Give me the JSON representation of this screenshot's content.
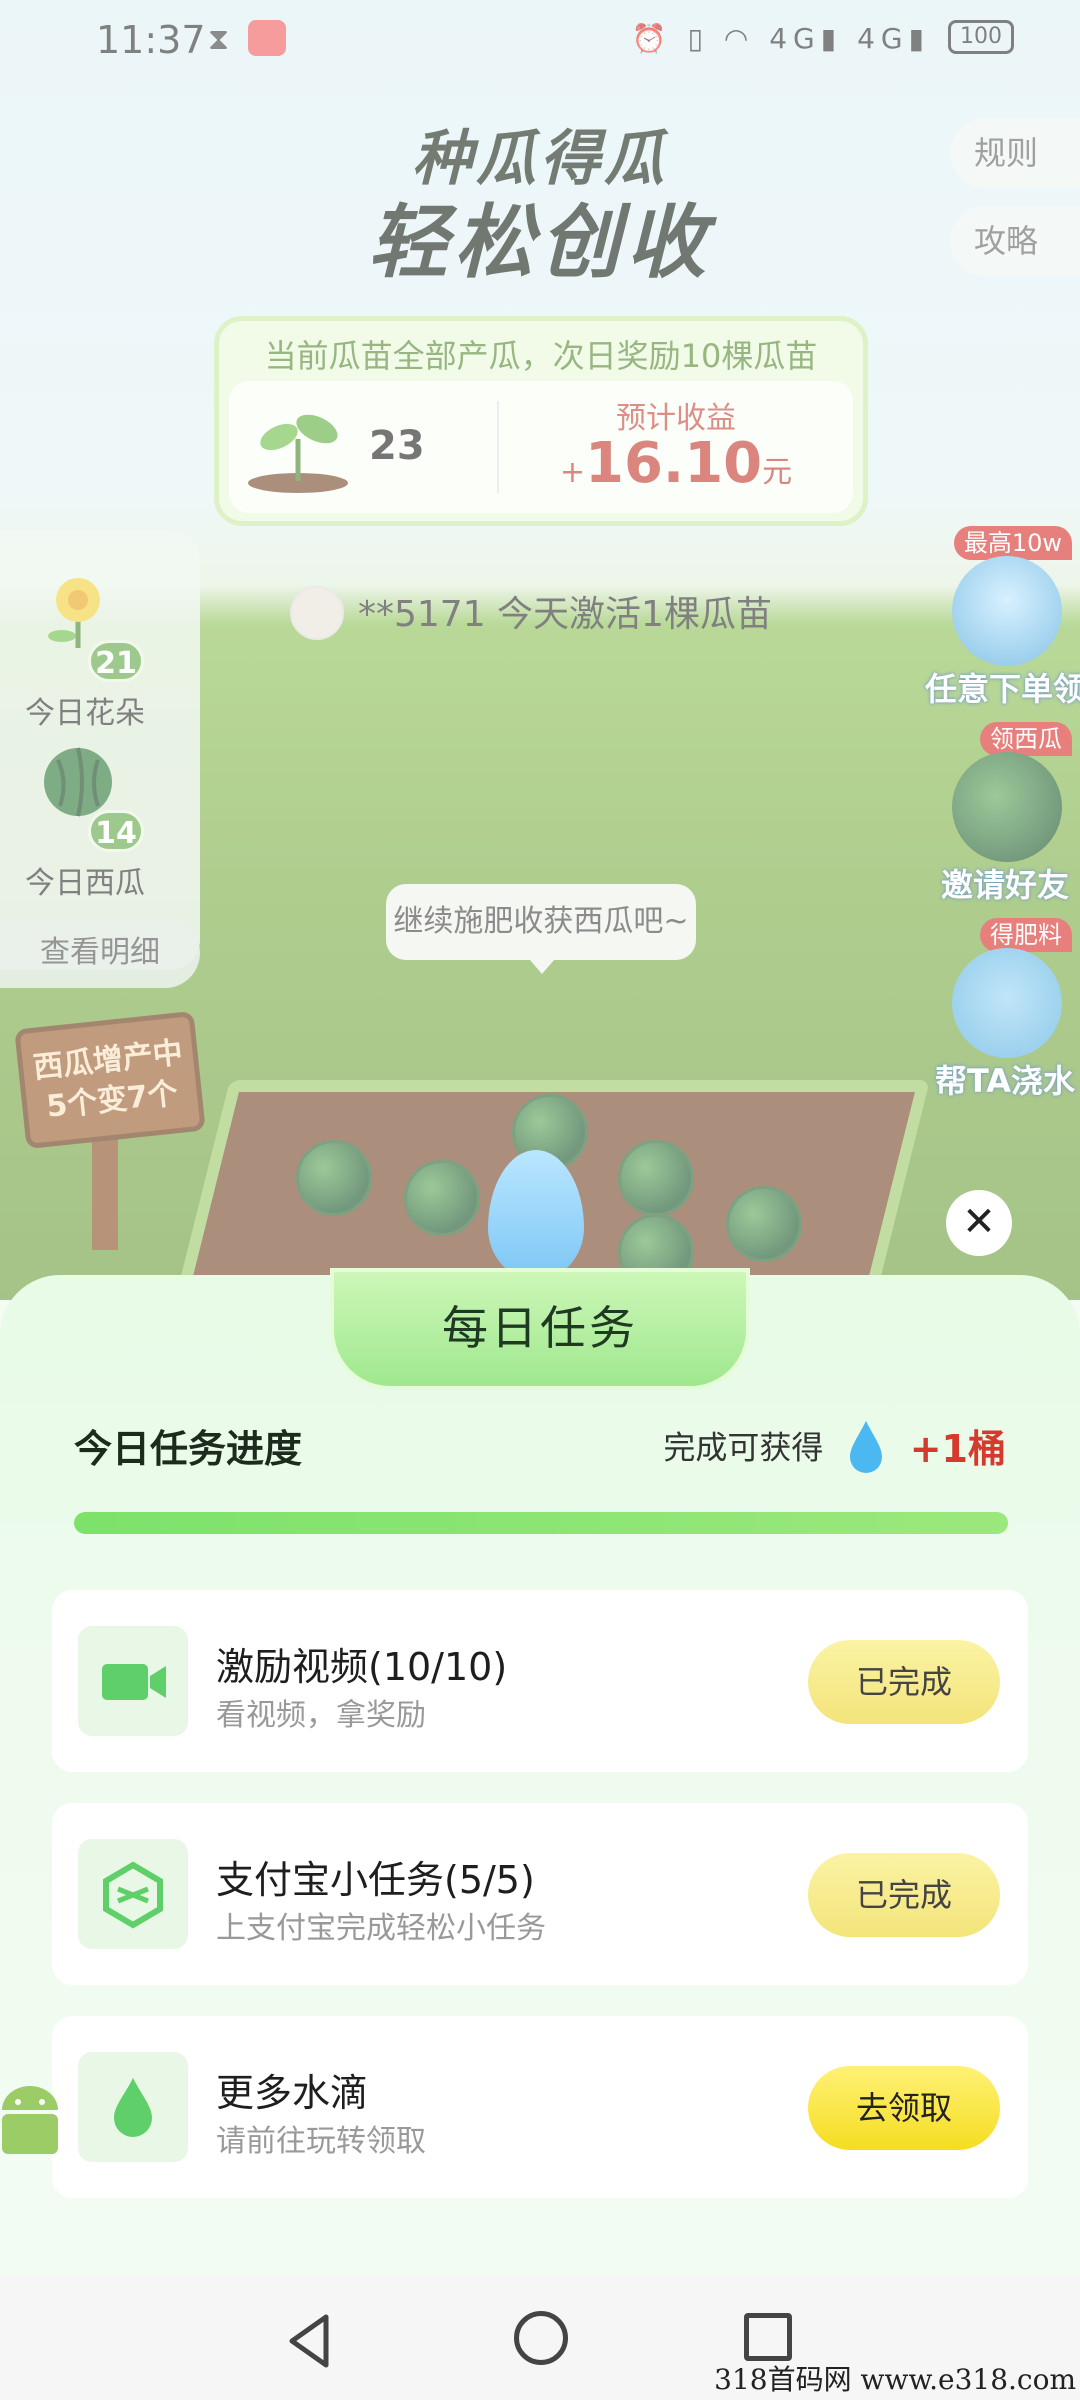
{
  "status_bar": {
    "time": "11:37",
    "battery": "100",
    "network": "4G"
  },
  "header": {
    "title_line1": "种瓜得瓜",
    "title_line2": "轻松创收",
    "rules_label": "规则",
    "guide_label": "攻略"
  },
  "banner": {
    "headline": "当前瓜苗全部产瓜，次日奖励10棵瓜苗",
    "seedling_count": "23",
    "estimate_label": "预计收益",
    "estimate_plus": "+",
    "estimate_value": "16.10",
    "estimate_unit": "元"
  },
  "left_panel": {
    "flowers": {
      "count": "21",
      "label": "今日花朵"
    },
    "melons": {
      "count": "14",
      "label": "今日西瓜"
    },
    "detail_button": "查看明细"
  },
  "notice": "**5171 今天激活1棵瓜苗",
  "right_panel": [
    {
      "tag": "最高10w",
      "label": "任意下单领"
    },
    {
      "tag": "领西瓜",
      "label": "邀请好友"
    },
    {
      "tag": "得肥料",
      "label": "帮TA浇水"
    }
  ],
  "tip_bubble": "继续施肥收获西瓜吧~",
  "sign_text": {
    "line1": "西瓜增产中",
    "line2": "5个变7个"
  },
  "sheet": {
    "title": "每日任务",
    "progress_title": "今日任务进度",
    "reward_label": "完成可获得",
    "reward_amount": "+1桶",
    "progress": 1.0,
    "tasks": [
      {
        "icon": "video-camera-icon",
        "title": "激励视频(10/10)",
        "subtitle": "看视频，拿奖励",
        "button": "已完成"
      },
      {
        "icon": "alipay-cube-icon",
        "title": "支付宝小任务(5/5)",
        "subtitle": "上支付宝完成轻松小任务",
        "button": "已完成"
      },
      {
        "icon": "water-drop-icon",
        "title": "更多水滴",
        "subtitle": "请前往玩转领取",
        "button": "去领取"
      }
    ]
  },
  "close_glyph": "✕",
  "watermark": "318首码网 www.e318.com",
  "colors": {
    "accent_green": "#63a947",
    "reward_red": "#d43a2e",
    "button_yellow": "#f5dd22"
  }
}
